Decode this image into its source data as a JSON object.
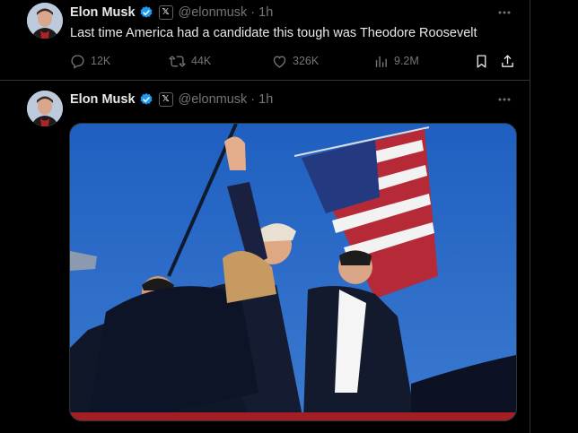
{
  "tweets": [
    {
      "author": {
        "name": "Elon Musk",
        "handle": "@elonmusk",
        "time": "1h",
        "affiliate_badge": "𝕏"
      },
      "text": "Last time America had a candidate this tough was Theodore Roosevelt",
      "stats": {
        "replies": "12K",
        "reposts": "44K",
        "likes": "326K",
        "views": "9.2M"
      }
    },
    {
      "author": {
        "name": "Elon Musk",
        "handle": "@elonmusk",
        "time": "1h",
        "affiliate_badge": "𝕏"
      },
      "media": {
        "kind": "photo"
      }
    }
  ],
  "colors": {
    "background": "#000000",
    "text": "#e7e9ea",
    "muted": "#71767b",
    "verified": "#1d9bf0",
    "border": "#2f3336"
  },
  "icons": [
    "verified-badge-icon",
    "x-logo-icon",
    "more-icon",
    "reply-icon",
    "retweet-icon",
    "like-icon",
    "views-icon",
    "bookmark-icon",
    "share-icon"
  ]
}
